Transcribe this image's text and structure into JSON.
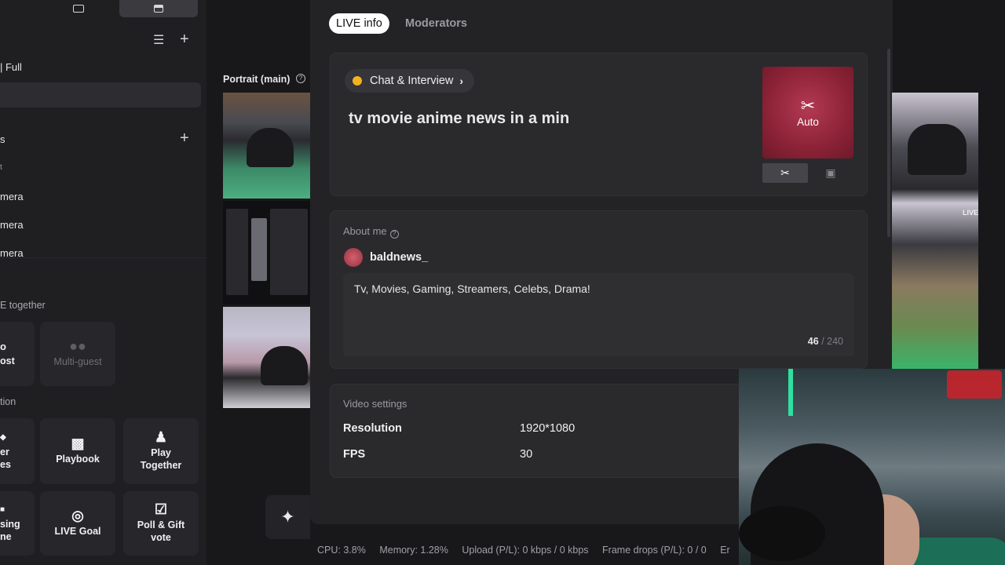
{
  "left_panel": {
    "scene_rows": [
      "| Full"
    ],
    "sources_rows": [
      "mera",
      "mera",
      "mera"
    ],
    "live_together_title": "E together",
    "partial_tile_1": "ost",
    "multiguest_label": "Multi-guest",
    "interaction_title": "tion",
    "partial_tile_2_line1": "er",
    "partial_tile_2_line2": "es",
    "playbook_label": "Playbook",
    "play_together_line1": "Play",
    "play_together_line2": "Together",
    "partial_tile_3_line1": "sing",
    "partial_tile_3_line2": "ne",
    "live_goal_label": "LIVE Goal",
    "poll_line1": "Poll & Gift",
    "poll_line2": "vote"
  },
  "preview": {
    "label": "Portrait (main)"
  },
  "modal": {
    "tabs": [
      {
        "label": "LIVE info",
        "active": true
      },
      {
        "label": "Moderators",
        "active": false
      }
    ],
    "category": "Chat & Interview",
    "stream_title": "tv movie anime news in a min",
    "cover_label": "Auto",
    "about_title": "About me",
    "username": "baldnews_",
    "bio": "Tv, Movies, Gaming, Streamers, Celebs, Drama!",
    "bio_count": "46",
    "bio_max": "/ 240",
    "video_settings_title": "Video settings",
    "video_settings": [
      {
        "label": "Resolution",
        "value": "1920*1080"
      },
      {
        "label": "FPS",
        "value": "30"
      }
    ]
  },
  "right": {
    "live_tag": "LIVE"
  },
  "status_bar": {
    "cpu": "CPU: 3.8%",
    "memory": "Memory: 1.28%",
    "upload": "Upload (P/L): 0 kbps / 0 kbps",
    "frame_drops": "Frame drops (P/L): 0 / 0",
    "tail": "Er"
  },
  "colors": {
    "accent_cover": "#8c2236",
    "category_dot": "#f4b21e",
    "background": "#18181b"
  }
}
